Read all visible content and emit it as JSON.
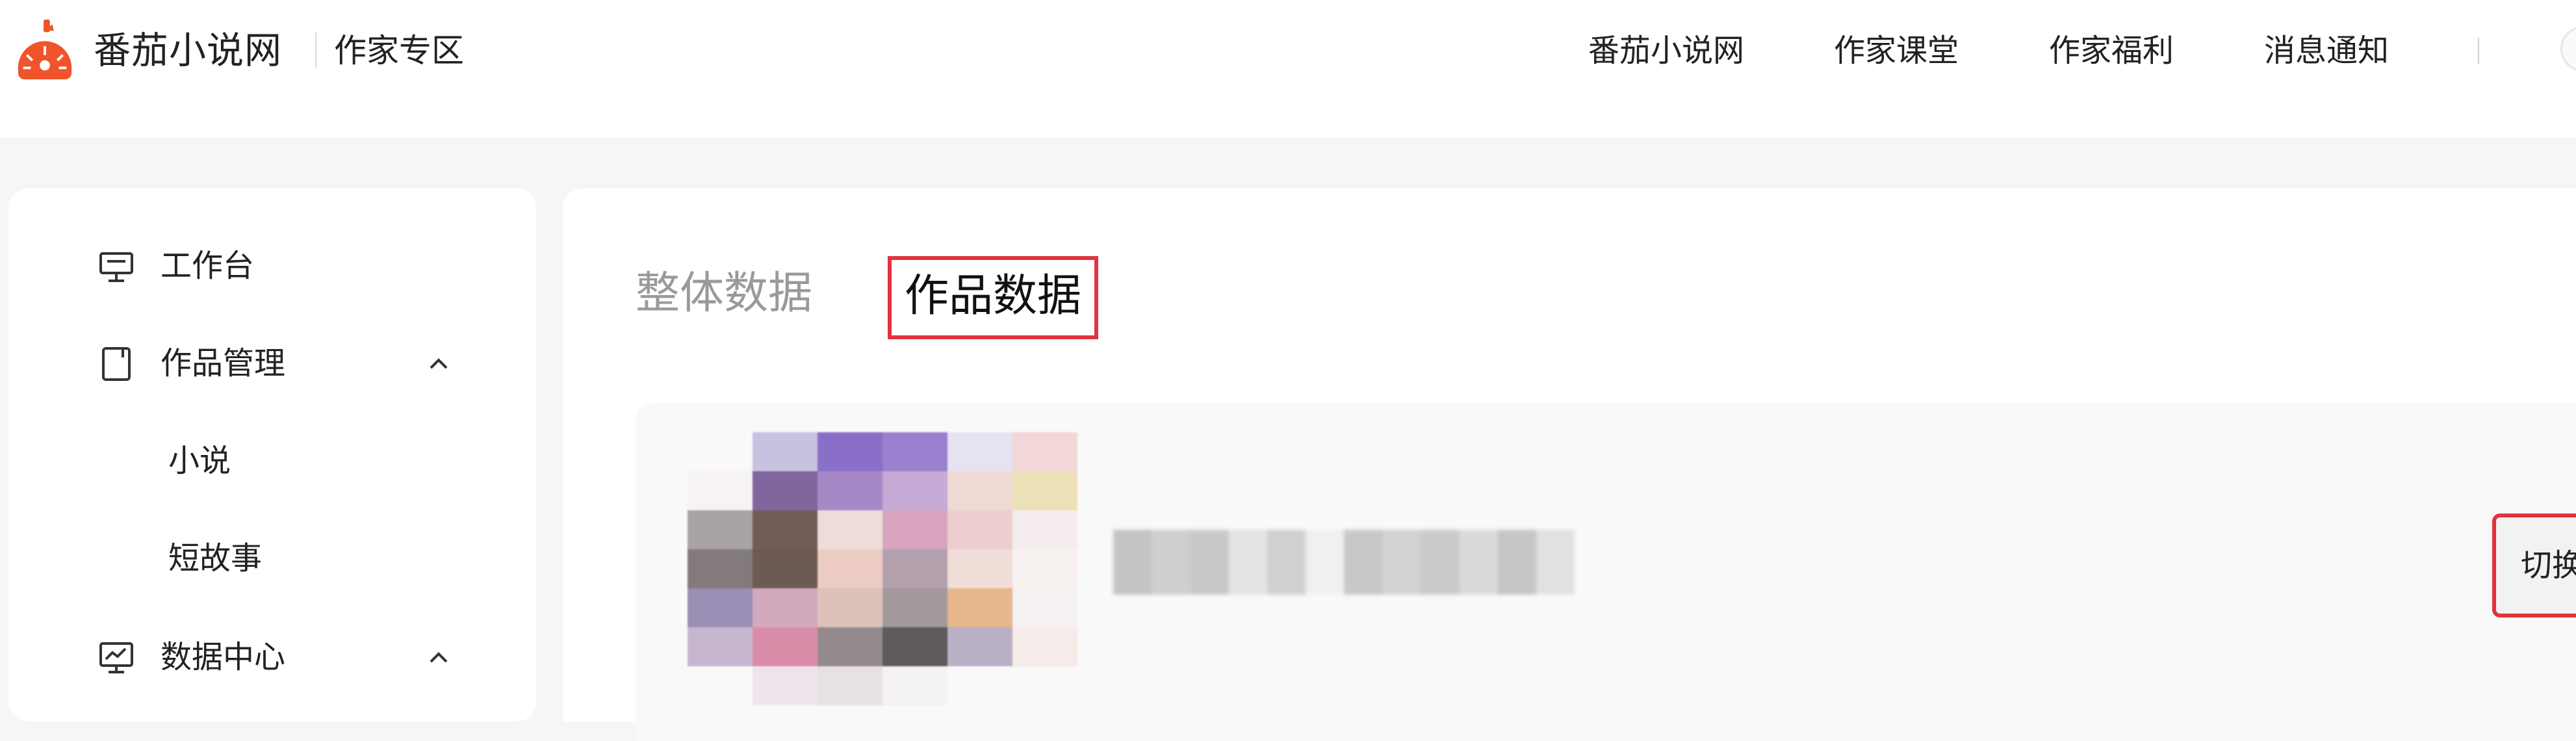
{
  "header": {
    "brand": "番茄小说网",
    "zone": "作家专区",
    "nav": [
      "番茄小说网",
      "作家课堂",
      "作家福利",
      "消息通知"
    ],
    "divider_text": "|"
  },
  "sidebar": {
    "items": [
      {
        "label": "工作台",
        "icon": "monitor-icon"
      },
      {
        "label": "作品管理",
        "icon": "book-icon",
        "expanded": true
      },
      {
        "label": "小说"
      },
      {
        "label": "短故事"
      },
      {
        "label": "数据中心",
        "icon": "chart-monitor-icon",
        "expanded": true
      }
    ]
  },
  "main": {
    "tabs": [
      {
        "label": "整体数据",
        "active": false
      },
      {
        "label": "作品数据",
        "active": true
      }
    ],
    "work": {
      "cover": "pixelated-cover-image",
      "title": "pixelated-work-title",
      "switch_label": "切换作品"
    }
  },
  "colors": {
    "brand": "#f0542a",
    "highlight": "#e0333f",
    "inactive_tab": "#9a9a9a"
  }
}
